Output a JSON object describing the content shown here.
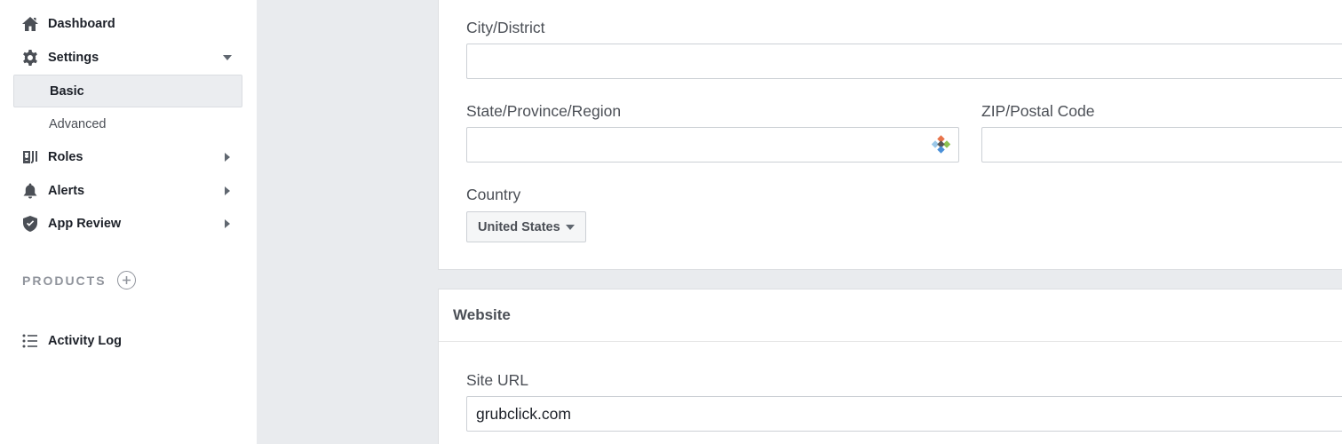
{
  "sidebar": {
    "items": [
      {
        "label": "Dashboard",
        "icon": "home-icon"
      },
      {
        "label": "Settings",
        "icon": "gear-icon",
        "expanded": true
      },
      {
        "label": "Basic",
        "active": true
      },
      {
        "label": "Advanced"
      },
      {
        "label": "Roles",
        "icon": "roles-icon"
      },
      {
        "label": "Alerts",
        "icon": "bell-icon"
      },
      {
        "label": "App Review",
        "icon": "shield-check-icon"
      }
    ],
    "products_label": "PRODUCTS",
    "activity_log": "Activity Log"
  },
  "address": {
    "city_label": "City/District",
    "city_value": "",
    "state_label": "State/Province/Region",
    "state_value": "",
    "zip_label": "ZIP/Postal Code",
    "zip_value": "",
    "country_label": "Country",
    "country_value": "United States"
  },
  "website": {
    "section_title": "Website",
    "site_url_label": "Site URL",
    "site_url_value": "grubclick.com"
  },
  "colors": {
    "page_bg": "#e9ebee",
    "active_item_bg": "#ebedf0",
    "label_text": "#4b4f56"
  }
}
